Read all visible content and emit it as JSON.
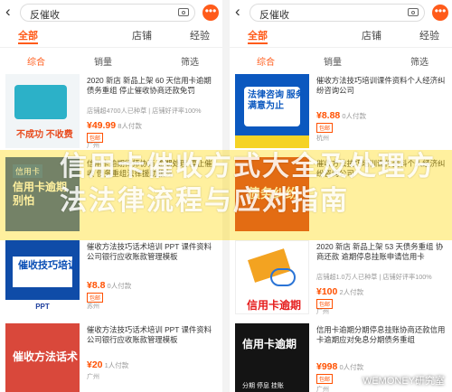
{
  "left": {
    "search": "反催收",
    "tabs": [
      "全部",
      "店铺",
      "经验"
    ],
    "filters": [
      "综合",
      "销量",
      "筛选"
    ],
    "items": [
      {
        "title": "2020 新店 新品上架 60 天信用卡逾期债务重组 停止催收协商还款免罚",
        "sub": "店铺超4700人已种草 | 店铺好评率100%",
        "price": "¥49.99",
        "paid": "8人付款",
        "badge": "包邮",
        "loc": "广州",
        "thumb": {
          "bg": "#f1f5f7",
          "text": "不成功 不收费",
          "accent": "#e84b1e"
        }
      },
      {
        "title": "信用卡逾期律师协商 逾期处理 停止催收 债务重组法律援助服务",
        "sub": "",
        "price": "",
        "paid": "",
        "badge": "",
        "loc": "",
        "thumb": {
          "bg": "#1f4ea6",
          "text": "信用卡逾期 别怕",
          "accent": "#fff"
        }
      },
      {
        "title": "催收方法技巧话术培训 PPT 课件资料公司银行应收账款管理模板",
        "sub": "",
        "price": "¥8.8",
        "paid": "0人付款",
        "badge": "包邮",
        "loc": "苏州",
        "thumb": {
          "bg": "#0f4ca8",
          "text": "催收技巧培训",
          "accent": "#fff"
        }
      },
      {
        "title": "催收方法技巧话术培训 PPT 课件资料公司银行应收账款管理模板",
        "sub": "",
        "price": "¥20",
        "paid": "1人付款",
        "badge": "",
        "loc": "广州",
        "thumb": {
          "bg": "#d9483b",
          "text": "催收方法话术",
          "accent": "#fff"
        }
      }
    ]
  },
  "right": {
    "search": "反催收",
    "tabs": [
      "全部",
      "店铺",
      "经验"
    ],
    "filters": [
      "综合",
      "销量",
      "筛选"
    ],
    "items": [
      {
        "title": "催收方法技巧培训课件资料个人经济纠纷咨询公司",
        "sub": "",
        "price": "¥8.88",
        "paid": "0人付款",
        "badge": "包邮",
        "loc": "杭州",
        "thumb": {
          "bg": "#0b58bf",
          "text": "法律咨询 服务满意为止",
          "accent": "#f5d326"
        }
      },
      {
        "title": "催收方法技巧培训课件资料个人经济纠纷咨询公司",
        "sub": "",
        "price": "",
        "paid": "",
        "badge": "",
        "loc": "",
        "thumb": {
          "bg": "#d22b1f",
          "text": "债务纠纷",
          "accent": "#fff"
        }
      },
      {
        "title": "2020 新店 新品上架 53 天债务重组 协商还款 逾期停息挂账申请信用卡",
        "sub": "店铺超1.0万人已种草 | 店铺好评率100%",
        "price": "¥100",
        "paid": "2人付款",
        "badge": "包邮",
        "loc": "广州",
        "thumb": {
          "bg": "#ffffff",
          "text": "信用卡逾期",
          "accent": "#e51c1c"
        }
      },
      {
        "title": "信用卡逾期分期停息挂账协商还款信用卡逾期应对免息分期债务重组",
        "sub": "",
        "price": "¥998",
        "paid": "0人付款",
        "badge": "包邮",
        "loc": "广州",
        "thumb": {
          "bg": "#141414",
          "text": "信用卡逾期",
          "accent": "#fff"
        }
      }
    ]
  },
  "overlay": {
    "headline": "信用卡催收方式大全及处理方法法律流程与应对指南"
  },
  "watermark": "WEMONEY研究室"
}
